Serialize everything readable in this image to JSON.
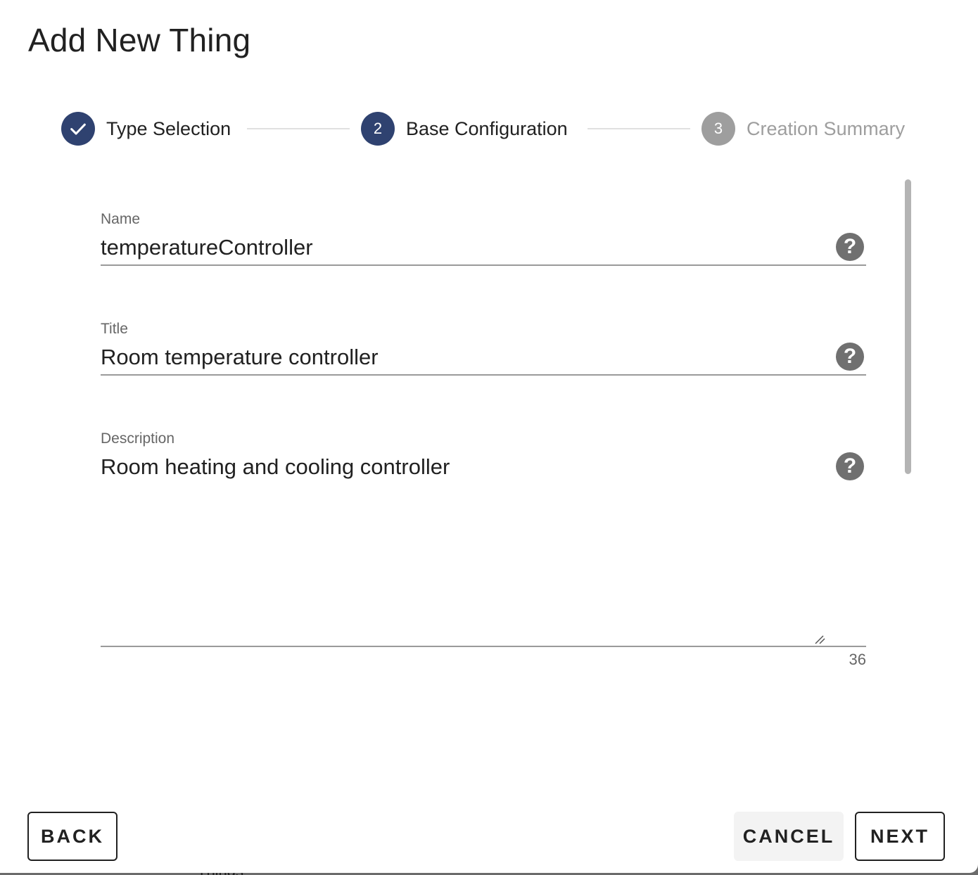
{
  "dialog": {
    "title": "Add New Thing"
  },
  "stepper": {
    "steps": [
      {
        "index": "1",
        "label": "Type Selection",
        "state": "completed",
        "icon": "check-icon"
      },
      {
        "index": "2",
        "label": "Base Configuration",
        "state": "active"
      },
      {
        "index": "3",
        "label": "Creation Summary",
        "state": "pending"
      }
    ]
  },
  "form": {
    "name": {
      "label": "Name",
      "value": "temperatureController",
      "help_icon": "help-circle-icon"
    },
    "title": {
      "label": "Title",
      "value": "Room temperature controller",
      "help_icon": "help-circle-icon"
    },
    "description": {
      "label": "Description",
      "value": "Room heating and cooling controller",
      "char_count": "36",
      "help_icon": "help-circle-icon"
    }
  },
  "actions": {
    "back_label": "BACK",
    "cancel_label": "CANCEL",
    "next_label": "NEXT"
  },
  "colors": {
    "primary": "#2f4270",
    "pending": "#9e9e9e",
    "text": "#212121",
    "label": "#666666"
  },
  "background": {
    "partial_text": "Things"
  }
}
